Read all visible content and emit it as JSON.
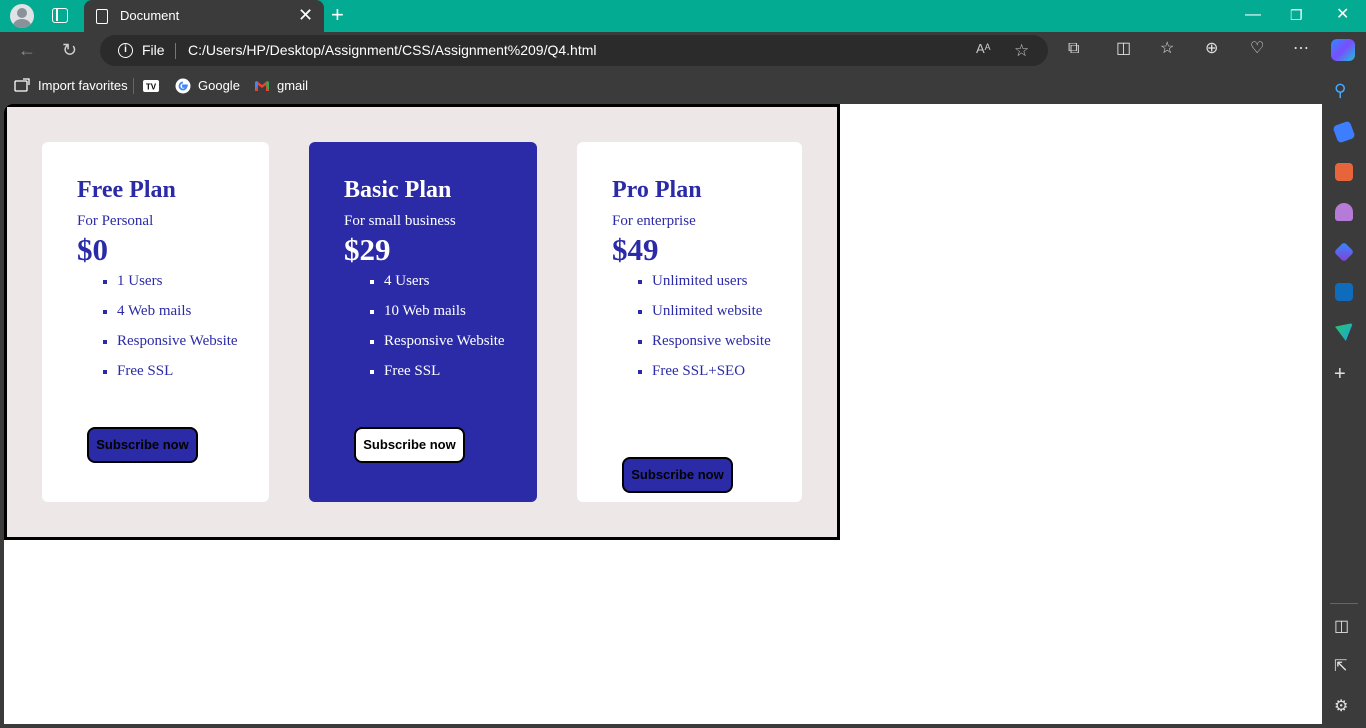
{
  "browser": {
    "tab_title": "Document",
    "omnibox_scheme": "File",
    "url": "C:/Users/HP/Desktop/Assignment/CSS/Assignment%209/Q4.html",
    "favorites": [
      "Import favorites",
      "Google",
      "gmail"
    ]
  },
  "plans": [
    {
      "name": "Free Plan",
      "subtitle": "For Personal",
      "price": "$0",
      "features": [
        "1 Users",
        "4 Web mails",
        "Responsive Website",
        "Free SSL"
      ],
      "button": "Subscribe now"
    },
    {
      "name": "Basic Plan",
      "subtitle": "For small business",
      "price": "$29",
      "features": [
        "4 Users",
        "10 Web mails",
        "Responsive Website",
        "Free SSL"
      ],
      "button": "Subscribe now"
    },
    {
      "name": "Pro Plan",
      "subtitle": "For enterprise",
      "price": "$49",
      "features": [
        "Unlimited users",
        "Unlimited website",
        "Responsive website",
        "Free SSL+SEO"
      ],
      "button": "Subscribe now"
    }
  ],
  "colors": {
    "accent": "#2b2ba8",
    "titlebar": "#03ab92",
    "container_bg": "#ede7e7"
  }
}
